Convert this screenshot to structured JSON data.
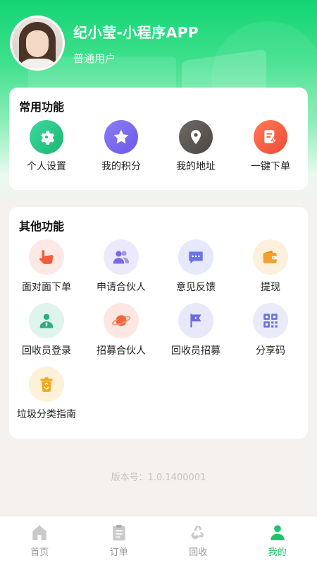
{
  "profile": {
    "name": "纪小莹-小程序APP",
    "role": "普通用户"
  },
  "common": {
    "title": "常用功能",
    "items": [
      {
        "label": "个人设置",
        "icon": "gear-icon"
      },
      {
        "label": "我的积分",
        "icon": "star-icon"
      },
      {
        "label": "我的地址",
        "icon": "location-pin-icon"
      },
      {
        "label": "一键下单",
        "icon": "order-lightning-icon"
      }
    ]
  },
  "other": {
    "title": "其他功能",
    "items": [
      {
        "label": "面对面下单",
        "icon": "hand-icon"
      },
      {
        "label": "申请合伙人",
        "icon": "partners-icon"
      },
      {
        "label": "意见反馈",
        "icon": "feedback-icon"
      },
      {
        "label": "提现",
        "icon": "wallet-icon"
      },
      {
        "label": "回收员登录",
        "icon": "collector-icon"
      },
      {
        "label": "招募合伙人",
        "icon": "planet-icon"
      },
      {
        "label": "回收员招募",
        "icon": "flag-icon"
      },
      {
        "label": "分享码",
        "icon": "qrcode-icon"
      },
      {
        "label": "垃圾分类指南",
        "icon": "trash-bin-icon"
      }
    ]
  },
  "version": "版本号：1.0.1400001",
  "tabbar": {
    "tabs": [
      {
        "label": "首页",
        "icon": "home-icon"
      },
      {
        "label": "订单",
        "icon": "clipboard-icon"
      },
      {
        "label": "回收",
        "icon": "recycle-icon"
      },
      {
        "label": "我的",
        "icon": "person-icon",
        "active": true
      }
    ]
  },
  "colors": {
    "accent": "#1ec66b",
    "tab_inactive": "#999999"
  }
}
